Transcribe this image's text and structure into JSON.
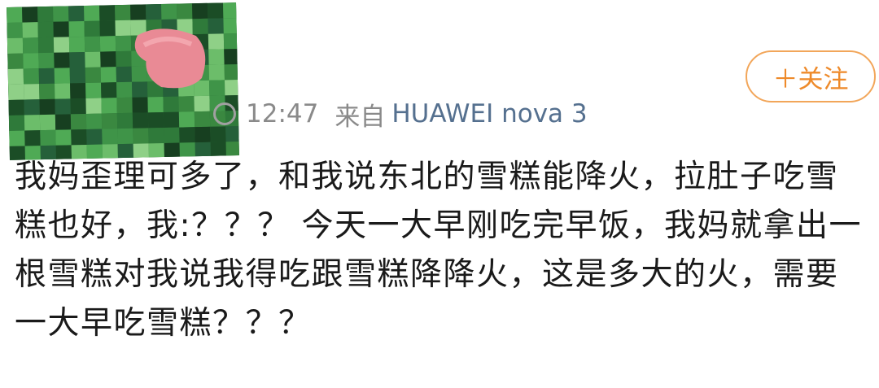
{
  "post": {
    "time": "12:47",
    "from_label": "来自",
    "device": "HUAWEI nova 3",
    "follow_label": "＋关注",
    "text": "我妈歪理可多了，和我说东北的雪糕能降火，拉肚子吃雪糕也好，我:？？？ 今天一大早刚吃完早饭，我妈就拿出一根雪糕对我说我得吃跟雪糕降降火，这是多大的火，需要一大早吃雪糕？？？"
  },
  "icons": {
    "avatar": "pixelated-avatar-image",
    "clock": "clock-icon"
  },
  "colors": {
    "follow_accent": "#ee8a2a",
    "device_link": "#55708f",
    "meta_gray": "#8a8a8a"
  }
}
